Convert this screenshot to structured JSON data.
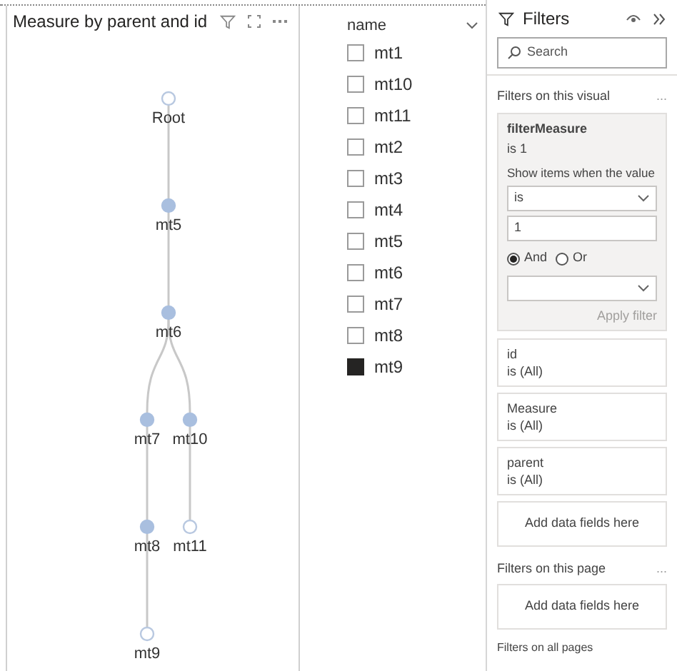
{
  "visual": {
    "title": "Measure by parent and id",
    "tree": {
      "label": "Root",
      "filled": false,
      "children": [
        {
          "label": "mt5",
          "filled": true,
          "children": [
            {
              "label": "mt6",
              "filled": true,
              "children": [
                {
                  "label": "mt7",
                  "filled": true,
                  "children": [
                    {
                      "label": "mt8",
                      "filled": true,
                      "children": [
                        {
                          "label": "mt9",
                          "filled": false
                        }
                      ]
                    }
                  ]
                },
                {
                  "label": "mt10",
                  "filled": true,
                  "children": [
                    {
                      "label": "mt11",
                      "filled": false
                    }
                  ]
                }
              ]
            }
          ]
        }
      ]
    }
  },
  "slicer": {
    "header": "name",
    "items": [
      {
        "label": "mt1",
        "checked": false
      },
      {
        "label": "mt10",
        "checked": false
      },
      {
        "label": "mt11",
        "checked": false
      },
      {
        "label": "mt2",
        "checked": false
      },
      {
        "label": "mt3",
        "checked": false
      },
      {
        "label": "mt4",
        "checked": false
      },
      {
        "label": "mt5",
        "checked": false
      },
      {
        "label": "mt6",
        "checked": false
      },
      {
        "label": "mt7",
        "checked": false
      },
      {
        "label": "mt8",
        "checked": false
      },
      {
        "label": "mt9",
        "checked": true
      }
    ]
  },
  "filters": {
    "title": "Filters",
    "search": {
      "placeholder": "Search"
    },
    "visual_section": {
      "heading": "Filters on this visual",
      "more": "...",
      "expanded_card": {
        "name": "filterMeasure",
        "summary": "is 1",
        "prompt": "Show items when the value",
        "operator": "is",
        "value": "1",
        "logic": [
          {
            "label": "And",
            "selected": true
          },
          {
            "label": "Or",
            "selected": false
          }
        ],
        "apply": "Apply filter"
      },
      "cards": [
        {
          "name": "id",
          "summary": "is (All)"
        },
        {
          "name": "Measure",
          "summary": "is (All)"
        },
        {
          "name": "parent",
          "summary": "is (All)"
        }
      ],
      "drop": "Add data fields here"
    },
    "page_section": {
      "heading": "Filters on this page",
      "more": "...",
      "drop": "Add data fields here"
    },
    "all_pages_heading": "Filters on all pages"
  }
}
